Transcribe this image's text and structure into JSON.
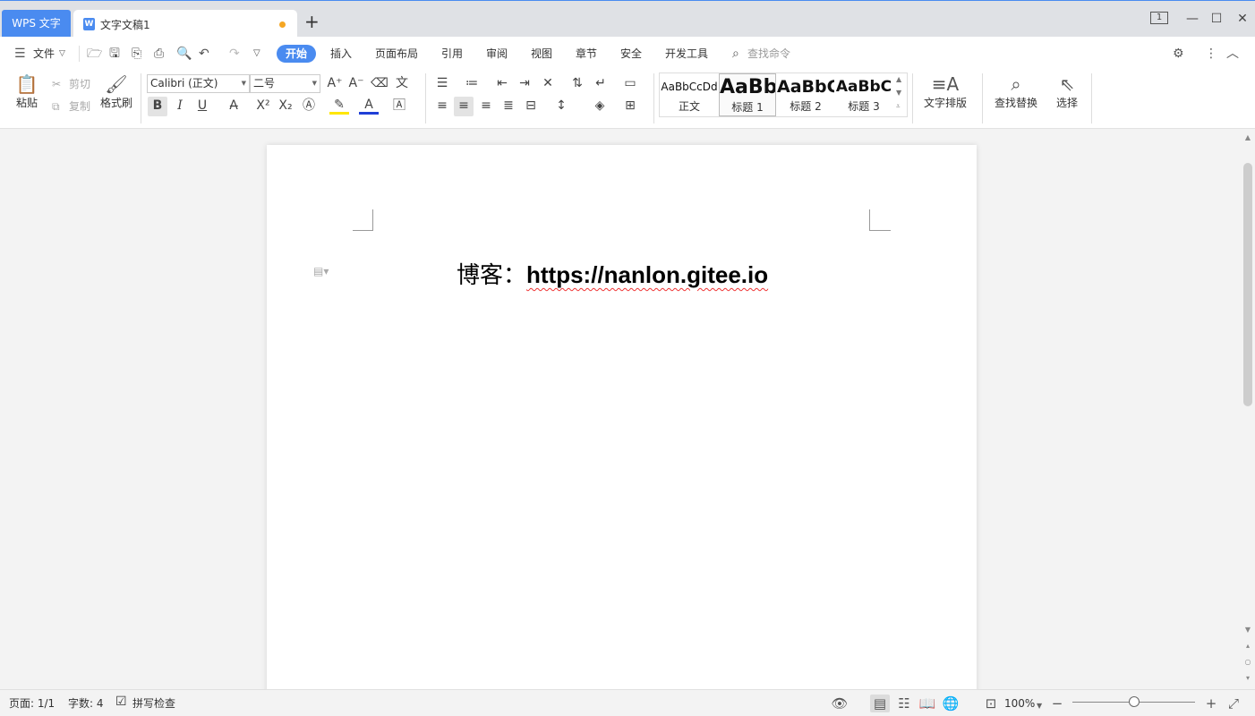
{
  "titlebar": {
    "app_tab": "WPS 文字",
    "doc_tab_icon": "W",
    "doc_title": "文字文稿1",
    "new_tab": "+",
    "controls": {
      "workspace": "1",
      "minimize": "—",
      "maximize": "☐",
      "close": "✕"
    }
  },
  "menu": {
    "file": "文件",
    "tabs": [
      "开始",
      "插入",
      "页面布局",
      "引用",
      "审阅",
      "视图",
      "章节",
      "安全",
      "开发工具"
    ],
    "search_placeholder": "查找命令"
  },
  "ribbon": {
    "paste": "粘贴",
    "cut": "剪切",
    "copy": "复制",
    "format_painter": "格式刷",
    "font_name": "Calibri (正文)",
    "font_size": "二号",
    "styles": [
      {
        "preview": "AaBbCcDd",
        "name": "正文"
      },
      {
        "preview": "AaBb",
        "name": "标题 1"
      },
      {
        "preview": "AaBbC",
        "name": "标题 2"
      },
      {
        "preview": "AaBbC",
        "name": "标题 3"
      }
    ],
    "text_layout": "文字排版",
    "find_replace": "查找替换",
    "select": "选择"
  },
  "document": {
    "text_cn": "博客：",
    "text_url": "https://nanlon.gitee.io"
  },
  "status": {
    "page": "页面: 1/1",
    "words": "字数: 4",
    "spellcheck": "拼写检查",
    "zoom": "100%",
    "zoom_level": 0.5
  },
  "colors": {
    "accent": "#4a8bf0",
    "highlight": "#ffe600",
    "font_color": "#1f3fd6",
    "unsaved_dot": "#f5a623"
  }
}
